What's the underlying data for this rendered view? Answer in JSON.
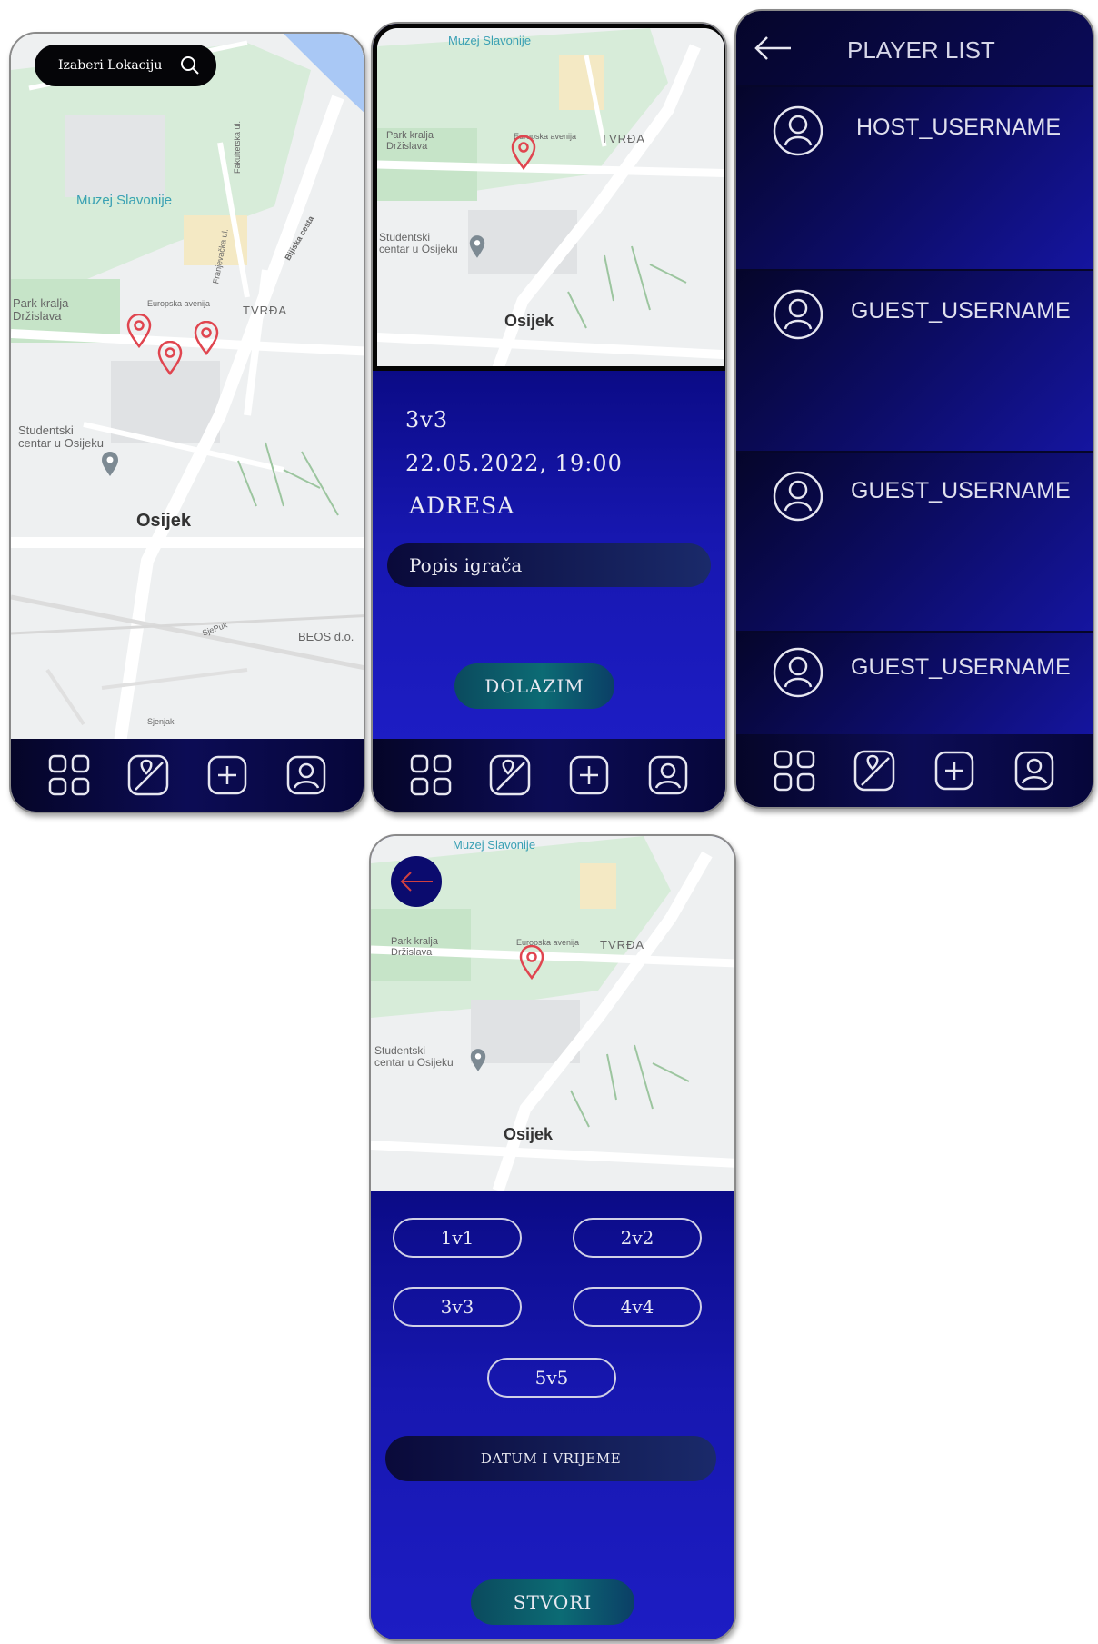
{
  "colors": {
    "accent_blue": "#1515a8",
    "nav_dark": "#07073a",
    "teal": "#0c6b74",
    "pin_red": "#e0454f",
    "map_green": "#c9e6cb"
  },
  "map": {
    "city": "Osijek",
    "museum": "Muzej Slavonije",
    "park": [
      "Park kralja",
      "Držislava"
    ],
    "student_center": [
      "Studentski",
      "centar u Osijeku"
    ],
    "district": "TVRĐA",
    "street_europska": "Europska avenija",
    "street_bijska": "Bijiska cesta",
    "street_fakultetska": "Fakultetska ul.",
    "street_franjevacka": "Franjevačka ul.",
    "beos": "BEOS d.o.",
    "sjenjak": "Sjenjak",
    "sjepuk": "SjePuk"
  },
  "screen_map": {
    "search_label": "Izaberi Lokaciju",
    "search_icon": "search-icon"
  },
  "screen_game": {
    "mode": "3v3",
    "datetime": "22.05.2022, 19:00",
    "address": "ADRESA",
    "player_list_button": "Popis igrača",
    "join_button": "DOLAZIM"
  },
  "screen_players": {
    "title": "PLAYER LIST",
    "players": [
      "HOST_USERNAME",
      "GUEST_USERNAME",
      "GUEST_USERNAME",
      "GUEST_USERNAME"
    ]
  },
  "screen_create": {
    "modes": [
      "1v1",
      "2v2",
      "3v3",
      "4v4",
      "5v5"
    ],
    "datetime_button": "DATUM I VRIJEME",
    "create_button": "STVORI"
  },
  "nav": {
    "icons": [
      "grid-icon",
      "map-icon",
      "add-icon",
      "profile-icon"
    ]
  }
}
